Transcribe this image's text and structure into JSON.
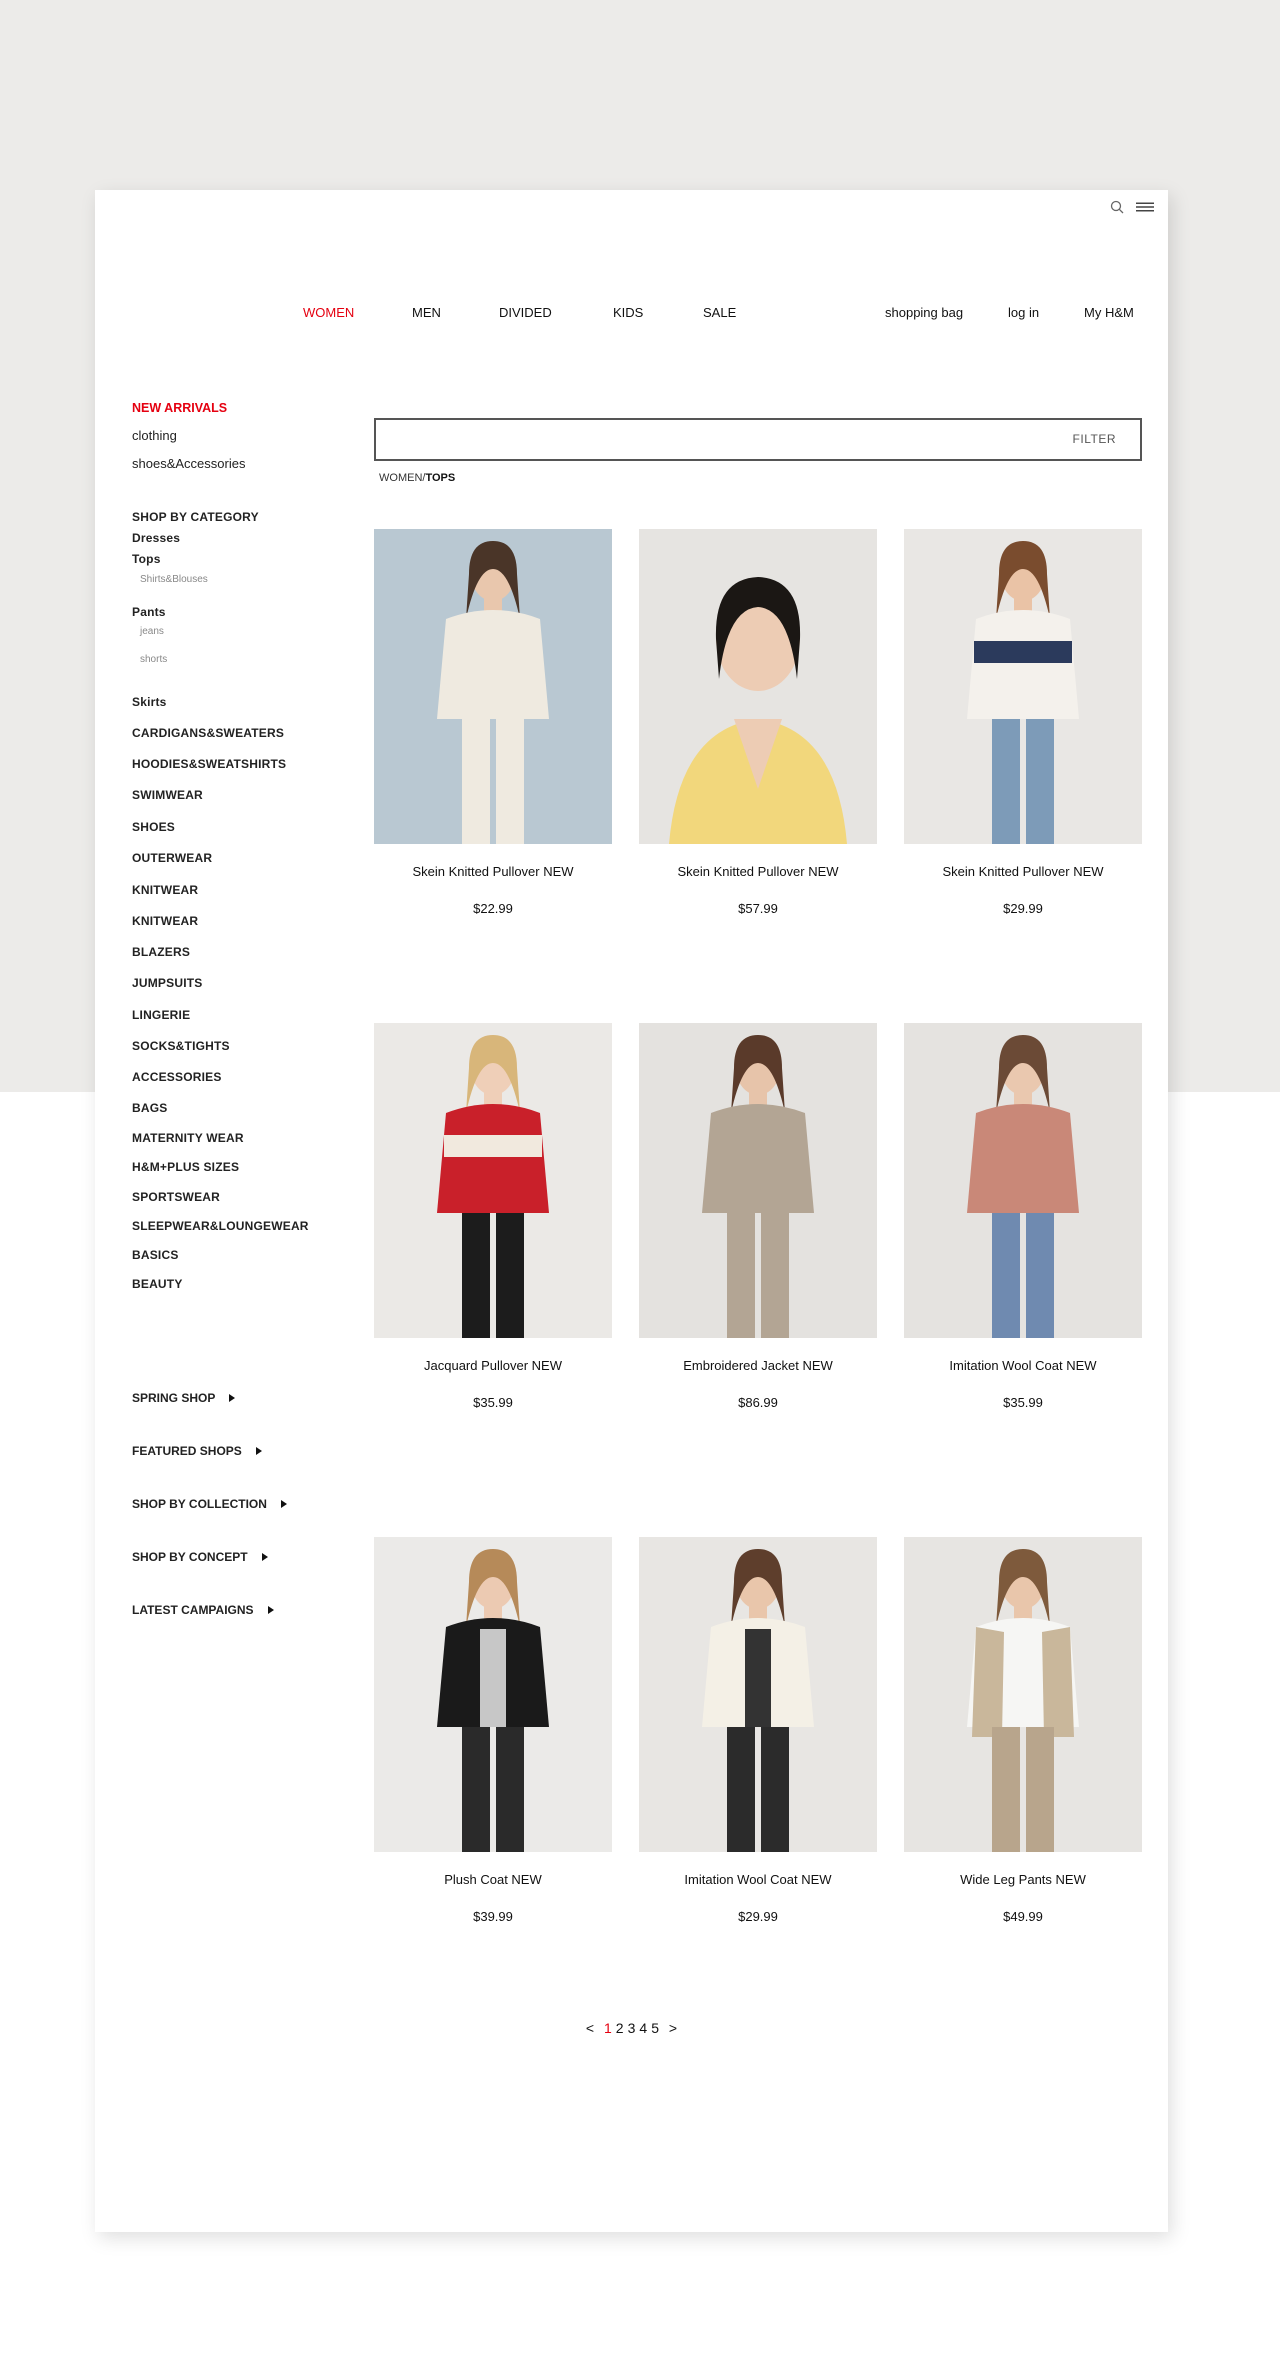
{
  "topnav": {
    "women": "WOMEN",
    "men": "MEN",
    "divided": "DIVIDED",
    "kids": "KIDS",
    "sale": "SALE",
    "bag": "shopping bag",
    "login": "log in",
    "account": "My H&M"
  },
  "sidebar": {
    "new_arrivals": "NEW ARRIVALS",
    "clothing": "clothing",
    "shoes": "shoes&Accessories",
    "shop_by_category": "SHOP BY CATEGORY",
    "dresses": "Dresses",
    "tops": "Tops",
    "shirts_blouses": "Shirts&Blouses",
    "pants": "Pants",
    "jeans": "jeans",
    "shorts": "shorts",
    "skirts": "Skirts",
    "categories": [
      "CARDIGANS&SWEATERS",
      "HOODIES&SWEATSHIRTS",
      "SWIMWEAR",
      "SHOES",
      "OUTERWEAR",
      "KNITWEAR",
      "KNITWEAR",
      "BLAZERS",
      "JUMPSUITS",
      "LINGERIE",
      "SOCKS&TIGHTS",
      "ACCESSORIES",
      "BAGS",
      "MATERNITY WEAR",
      "H&M+PLUS SIZES",
      "SPORTSWEAR",
      "SLEEPWEAR&LOUNGEWEAR",
      "BASICS",
      "BEAUTY"
    ],
    "shops": [
      "SPRING SHOP",
      "FEATURED SHOPS",
      "SHOP BY COLLECTION",
      "SHOP BY CONCEPT",
      "LATEST CAMPAIGNS"
    ]
  },
  "search": {
    "placeholder": "",
    "filter_label": "FILTER"
  },
  "breadcrumb": {
    "root": "WOMEN/",
    "current": "TOPS"
  },
  "products": [
    {
      "name": "Skein Knitted Pullover NEW",
      "price": "$22.99"
    },
    {
      "name": "Skein Knitted Pullover NEW",
      "price": "$57.99"
    },
    {
      "name": "Skein Knitted Pullover NEW",
      "price": "$29.99"
    },
    {
      "name": "Jacquard Pullover NEW",
      "price": "$35.99"
    },
    {
      "name": "Embroidered Jacket NEW",
      "price": "$86.99"
    },
    {
      "name": "Imitation Wool Coat NEW",
      "price": "$35.99"
    },
    {
      "name": "Plush Coat NEW",
      "price": "$39.99"
    },
    {
      "name": "Imitation Wool Coat NEW",
      "price": "$29.99"
    },
    {
      "name": "Wide Leg Pants NEW",
      "price": "$49.99"
    }
  ],
  "pagination": {
    "prev": "<",
    "pages": [
      "1",
      "2",
      "3",
      "4",
      "5"
    ],
    "current": "1",
    "next": ">"
  },
  "colors": {
    "accent": "#e50010",
    "background": "#ecebe9"
  },
  "icons": [
    "search-icon",
    "menu-icon",
    "triangle-right-icon"
  ]
}
